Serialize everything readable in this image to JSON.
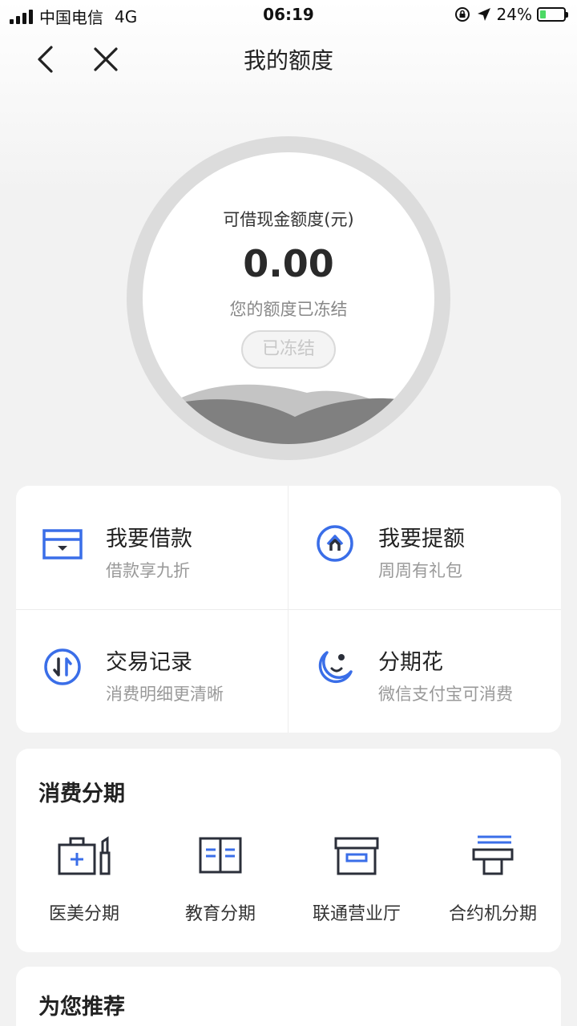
{
  "status_bar": {
    "carrier": "中国电信",
    "network": "4G",
    "time": "06:19",
    "battery": "24%",
    "battery_level": 0.24
  },
  "nav": {
    "title": "我的额度"
  },
  "credit": {
    "label": "可借现金额度(元)",
    "amount": "0.00",
    "status": "您的额度已冻结",
    "frozen_button": "已冻结"
  },
  "quick_actions": [
    {
      "title": "我要借款",
      "subtitle": "借款享九折",
      "icon": "loan-card-icon"
    },
    {
      "title": "我要提额",
      "subtitle": "周周有礼包",
      "icon": "raise-limit-icon"
    },
    {
      "title": "交易记录",
      "subtitle": "消费明细更清晰",
      "icon": "transaction-record-icon"
    },
    {
      "title": "分期花",
      "subtitle": "微信支付宝可消费",
      "icon": "installment-moon-icon"
    }
  ],
  "installments": {
    "title": "消费分期",
    "items": [
      {
        "label": "医美分期",
        "icon": "medical-beauty-icon"
      },
      {
        "label": "教育分期",
        "icon": "education-book-icon"
      },
      {
        "label": "联通营业厅",
        "icon": "unicom-box-icon"
      },
      {
        "label": "合约机分期",
        "icon": "contract-phone-icon"
      }
    ]
  },
  "recommend": {
    "title": "为您推荐"
  },
  "colors": {
    "accent": "#3a6ee8",
    "dark_icon": "#2b2f3a"
  }
}
